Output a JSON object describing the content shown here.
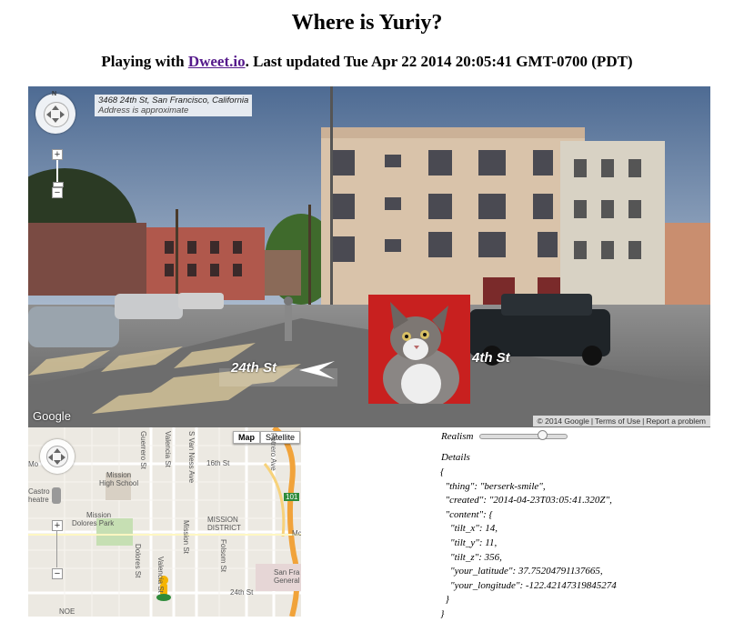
{
  "title": "Where is Yuriy?",
  "subtitle": {
    "prefix": "Playing with ",
    "link_text": "Dweet.io",
    "suffix": ". Last updated Tue Apr 22 2014 20:05:41 GMT-0700 (PDT)"
  },
  "street_view": {
    "address_line": "3468 24th St, San Francisco, California",
    "address_note": "Address is approximate",
    "compass_letter": "N",
    "zoom_in": "+",
    "zoom_out": "−",
    "street_label_left": "24th St",
    "street_label_right": "4th St",
    "logo": "Google",
    "footer": {
      "copyright": "© 2014 Google",
      "terms": "Terms of Use",
      "report": "Report a problem"
    }
  },
  "map": {
    "mode_map": "Map",
    "mode_satellite": "Satellite",
    "zoom_in": "+",
    "zoom_out": "−",
    "labels": {
      "mission_high": "Mission",
      "mission_high2": "High School",
      "castro": "Castro",
      "theatre": "heatre",
      "mission_dolores": "Mission",
      "mission_dolores2": "Dolores Park",
      "mission_district": "MISSION",
      "mission_district2": "DISTRICT",
      "sixteenth": "16th St",
      "twentyfourth": "24th St",
      "sf_general": "San Fra",
      "sf_general2": "General H",
      "guerrero": "Guerrero St",
      "valencia": "Valencia St",
      "van_ness": "S Van Ness Ave",
      "mission_st": "Mission St",
      "folsom": "Folsom St",
      "dolores": "Dolores St",
      "valencia2": "Valencia St",
      "potrero": "Potrero Ave",
      "mc": "Mc",
      "mo": "Mo",
      "noe": "NOE",
      "hwy": "101"
    }
  },
  "realism": {
    "label": "Realism",
    "value": 0.75
  },
  "details": {
    "label": "Details",
    "lines": [
      "{",
      "  \"thing\": \"berserk-smile\",",
      "  \"created\": \"2014-04-23T03:05:41.320Z\",",
      "  \"content\": {",
      "    \"tilt_x\": 14,",
      "    \"tilt_y\": 11,",
      "    \"tilt_z\": 356,",
      "    \"your_latitude\": 37.75204791137665,",
      "    \"your_longitude\": -122.42147319845274",
      "  }",
      "}"
    ]
  }
}
